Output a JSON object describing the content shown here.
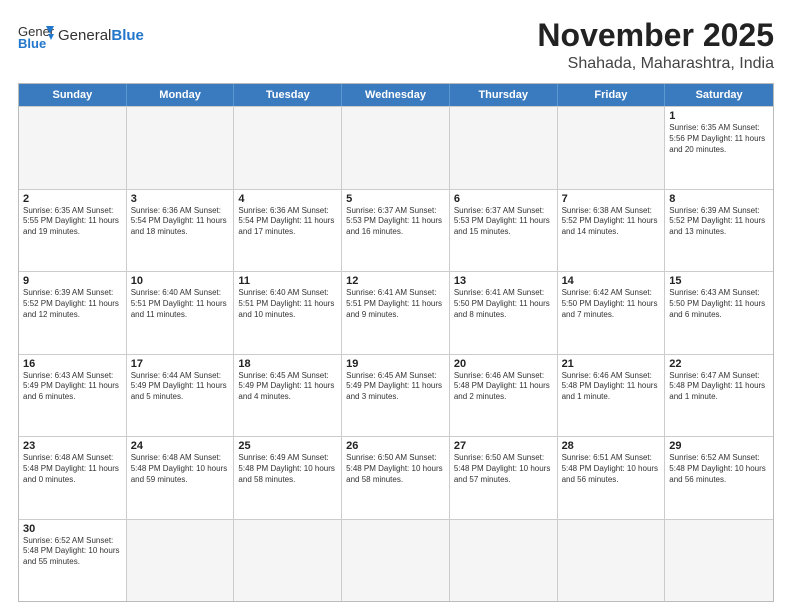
{
  "header": {
    "logo_general": "General",
    "logo_blue": "Blue",
    "month_title": "November 2025",
    "location": "Shahada, Maharashtra, India"
  },
  "weekdays": [
    "Sunday",
    "Monday",
    "Tuesday",
    "Wednesday",
    "Thursday",
    "Friday",
    "Saturday"
  ],
  "weeks": [
    [
      {
        "day": "",
        "info": ""
      },
      {
        "day": "",
        "info": ""
      },
      {
        "day": "",
        "info": ""
      },
      {
        "day": "",
        "info": ""
      },
      {
        "day": "",
        "info": ""
      },
      {
        "day": "",
        "info": ""
      },
      {
        "day": "1",
        "info": "Sunrise: 6:35 AM\nSunset: 5:56 PM\nDaylight: 11 hours\nand 20 minutes."
      }
    ],
    [
      {
        "day": "2",
        "info": "Sunrise: 6:35 AM\nSunset: 5:55 PM\nDaylight: 11 hours\nand 19 minutes."
      },
      {
        "day": "3",
        "info": "Sunrise: 6:36 AM\nSunset: 5:54 PM\nDaylight: 11 hours\nand 18 minutes."
      },
      {
        "day": "4",
        "info": "Sunrise: 6:36 AM\nSunset: 5:54 PM\nDaylight: 11 hours\nand 17 minutes."
      },
      {
        "day": "5",
        "info": "Sunrise: 6:37 AM\nSunset: 5:53 PM\nDaylight: 11 hours\nand 16 minutes."
      },
      {
        "day": "6",
        "info": "Sunrise: 6:37 AM\nSunset: 5:53 PM\nDaylight: 11 hours\nand 15 minutes."
      },
      {
        "day": "7",
        "info": "Sunrise: 6:38 AM\nSunset: 5:52 PM\nDaylight: 11 hours\nand 14 minutes."
      },
      {
        "day": "8",
        "info": "Sunrise: 6:39 AM\nSunset: 5:52 PM\nDaylight: 11 hours\nand 13 minutes."
      }
    ],
    [
      {
        "day": "9",
        "info": "Sunrise: 6:39 AM\nSunset: 5:52 PM\nDaylight: 11 hours\nand 12 minutes."
      },
      {
        "day": "10",
        "info": "Sunrise: 6:40 AM\nSunset: 5:51 PM\nDaylight: 11 hours\nand 11 minutes."
      },
      {
        "day": "11",
        "info": "Sunrise: 6:40 AM\nSunset: 5:51 PM\nDaylight: 11 hours\nand 10 minutes."
      },
      {
        "day": "12",
        "info": "Sunrise: 6:41 AM\nSunset: 5:51 PM\nDaylight: 11 hours\nand 9 minutes."
      },
      {
        "day": "13",
        "info": "Sunrise: 6:41 AM\nSunset: 5:50 PM\nDaylight: 11 hours\nand 8 minutes."
      },
      {
        "day": "14",
        "info": "Sunrise: 6:42 AM\nSunset: 5:50 PM\nDaylight: 11 hours\nand 7 minutes."
      },
      {
        "day": "15",
        "info": "Sunrise: 6:43 AM\nSunset: 5:50 PM\nDaylight: 11 hours\nand 6 minutes."
      }
    ],
    [
      {
        "day": "16",
        "info": "Sunrise: 6:43 AM\nSunset: 5:49 PM\nDaylight: 11 hours\nand 6 minutes."
      },
      {
        "day": "17",
        "info": "Sunrise: 6:44 AM\nSunset: 5:49 PM\nDaylight: 11 hours\nand 5 minutes."
      },
      {
        "day": "18",
        "info": "Sunrise: 6:45 AM\nSunset: 5:49 PM\nDaylight: 11 hours\nand 4 minutes."
      },
      {
        "day": "19",
        "info": "Sunrise: 6:45 AM\nSunset: 5:49 PM\nDaylight: 11 hours\nand 3 minutes."
      },
      {
        "day": "20",
        "info": "Sunrise: 6:46 AM\nSunset: 5:48 PM\nDaylight: 11 hours\nand 2 minutes."
      },
      {
        "day": "21",
        "info": "Sunrise: 6:46 AM\nSunset: 5:48 PM\nDaylight: 11 hours\nand 1 minute."
      },
      {
        "day": "22",
        "info": "Sunrise: 6:47 AM\nSunset: 5:48 PM\nDaylight: 11 hours\nand 1 minute."
      }
    ],
    [
      {
        "day": "23",
        "info": "Sunrise: 6:48 AM\nSunset: 5:48 PM\nDaylight: 11 hours\nand 0 minutes."
      },
      {
        "day": "24",
        "info": "Sunrise: 6:48 AM\nSunset: 5:48 PM\nDaylight: 10 hours\nand 59 minutes."
      },
      {
        "day": "25",
        "info": "Sunrise: 6:49 AM\nSunset: 5:48 PM\nDaylight: 10 hours\nand 58 minutes."
      },
      {
        "day": "26",
        "info": "Sunrise: 6:50 AM\nSunset: 5:48 PM\nDaylight: 10 hours\nand 58 minutes."
      },
      {
        "day": "27",
        "info": "Sunrise: 6:50 AM\nSunset: 5:48 PM\nDaylight: 10 hours\nand 57 minutes."
      },
      {
        "day": "28",
        "info": "Sunrise: 6:51 AM\nSunset: 5:48 PM\nDaylight: 10 hours\nand 56 minutes."
      },
      {
        "day": "29",
        "info": "Sunrise: 6:52 AM\nSunset: 5:48 PM\nDaylight: 10 hours\nand 56 minutes."
      }
    ],
    [
      {
        "day": "30",
        "info": "Sunrise: 6:52 AM\nSunset: 5:48 PM\nDaylight: 10 hours\nand 55 minutes."
      },
      {
        "day": "",
        "info": ""
      },
      {
        "day": "",
        "info": ""
      },
      {
        "day": "",
        "info": ""
      },
      {
        "day": "",
        "info": ""
      },
      {
        "day": "",
        "info": ""
      },
      {
        "day": "",
        "info": ""
      }
    ]
  ]
}
